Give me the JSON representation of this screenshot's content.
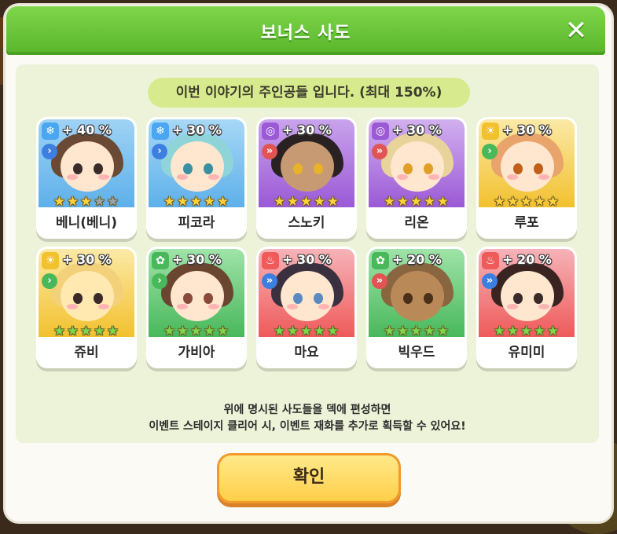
{
  "dialog": {
    "title": "보너스 사도",
    "close_icon": "close-icon",
    "subtitle": "이번 이야기의 주인공들 입니다. (최대 150%)",
    "info_line1": "위에 명시된 사도들을 덱에 편성하면",
    "info_line2": "이벤트 스테이지 클리어 시, 이벤트 재화를 추가로 획득할 수 있어요!",
    "confirm_label": "확인"
  },
  "colors": {
    "header_green": "#58b52a",
    "panel": "#ecf3d8",
    "confirm_yellow": "#ffcf4a",
    "water": "#4aa6f0",
    "dark": "#9b59d6",
    "light": "#f2c12e",
    "nature": "#49b85b",
    "fire": "#ef5a5a"
  },
  "cards": [
    {
      "name": "베니(베니)",
      "bonus": "+ 40 %",
      "element": "water-icon",
      "role": "chevron-right-icon",
      "stars": 3,
      "max_stars": 5
    },
    {
      "name": "피코라",
      "bonus": "+ 30 %",
      "element": "water-icon",
      "role": "chevron-right-icon",
      "stars": 5,
      "max_stars": 5
    },
    {
      "name": "스노키",
      "bonus": "+ 30 %",
      "element": "dark-swirl-icon",
      "role": "double-chevron-icon",
      "stars": 5,
      "max_stars": 5
    },
    {
      "name": "리온",
      "bonus": "+ 30 %",
      "element": "dark-swirl-icon",
      "role": "double-chevron-icon",
      "stars": 5,
      "max_stars": 5
    },
    {
      "name": "루포",
      "bonus": "+ 30 %",
      "element": "light-sun-icon",
      "role": "chevron-right-icon",
      "stars": 5,
      "max_stars": 5
    },
    {
      "name": "쥬비",
      "bonus": "+ 30 %",
      "element": "light-sun-icon",
      "role": "chevron-right-icon",
      "stars": 5,
      "max_stars": 5
    },
    {
      "name": "가비아",
      "bonus": "+ 30 %",
      "element": "nature-leaf-icon",
      "role": "chevron-right-icon",
      "stars": 5,
      "max_stars": 5
    },
    {
      "name": "마요",
      "bonus": "+ 30 %",
      "element": "fire-icon",
      "role": "double-chevron-icon",
      "stars": 5,
      "max_stars": 5
    },
    {
      "name": "빅우드",
      "bonus": "+ 20 %",
      "element": "nature-leaf-icon",
      "role": "double-chevron-icon",
      "stars": 5,
      "max_stars": 5
    },
    {
      "name": "유미미",
      "bonus": "+ 20 %",
      "element": "fire-icon",
      "role": "double-chevron-icon",
      "stars": 5,
      "max_stars": 5
    }
  ]
}
